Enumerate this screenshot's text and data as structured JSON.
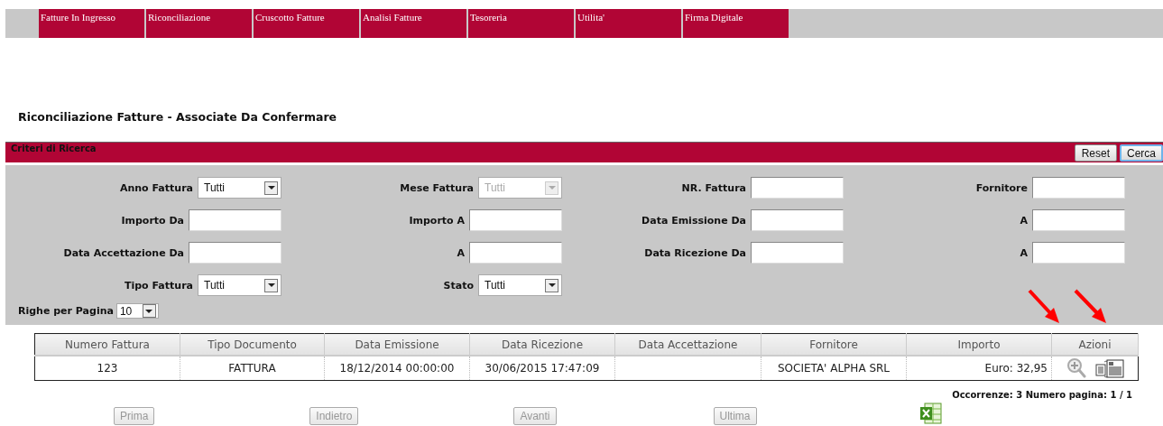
{
  "menu": [
    {
      "label": "Fatture In Ingresso"
    },
    {
      "label": "Riconciliazione"
    },
    {
      "label": "Cruscotto Fatture"
    },
    {
      "label": "Analisi Fatture"
    },
    {
      "label": "Tesoreria"
    },
    {
      "label": "Utilita'"
    },
    {
      "label": "Firma Digitale"
    }
  ],
  "page_title": "Riconciliazione Fatture - Associate Da Confermare",
  "search_panel": {
    "title": "Criteri di Ricerca",
    "buttons": [
      {
        "label": "Reset",
        "focused": false
      },
      {
        "label": "Cerca",
        "focused": true
      }
    ],
    "rows": [
      [
        {
          "label": "Anno Fattura",
          "kind": "select",
          "value": "Tutti",
          "disabled": false
        },
        {
          "label": "Mese Fattura",
          "kind": "select",
          "value": "Tutti",
          "disabled": true
        },
        {
          "label": "NR. Fattura",
          "kind": "text"
        },
        {
          "label": "Fornitore",
          "kind": "text"
        }
      ],
      [
        {
          "label": "Importo Da",
          "kind": "text"
        },
        {
          "label": "Importo A",
          "kind": "text"
        },
        {
          "label": "Data Emissione Da",
          "kind": "text"
        },
        {
          "label": "A",
          "kind": "text"
        }
      ],
      [
        {
          "label": "Data Accettazione Da",
          "kind": "text"
        },
        {
          "label": "A",
          "kind": "text"
        },
        {
          "label": "Data Ricezione Da",
          "kind": "text"
        },
        {
          "label": "A",
          "kind": "text"
        }
      ],
      [
        {
          "label": "Tipo Fattura",
          "kind": "select",
          "value": "Tutti",
          "disabled": false
        },
        {
          "label": "Stato",
          "kind": "select",
          "value": "Tutti",
          "disabled": false
        }
      ]
    ],
    "rows_per_page": {
      "label": "Righe per Pagina",
      "value": "10"
    }
  },
  "table": {
    "columns": [
      "Numero Fattura",
      "Tipo Documento",
      "Data Emissione",
      "Data Ricezione",
      "Data Accettazione",
      "Fornitore",
      "Importo",
      "Azioni"
    ],
    "rows": [
      {
        "cells": [
          "123",
          "FATTURA",
          "18/12/2014 00:00:00",
          "30/06/2015 17:47:09",
          "",
          "SOCIETA' ALPHA SRL",
          "Euro: 32,95"
        ]
      }
    ]
  },
  "status": "Occorrenze: 3 Numero pagina: 1 / 1",
  "pagination": [
    {
      "label": "Prima",
      "disabled": true
    },
    {
      "label": "Indietro",
      "disabled": true
    },
    {
      "label": "Avanti",
      "disabled": true
    },
    {
      "label": "Ultima",
      "disabled": true
    }
  ]
}
